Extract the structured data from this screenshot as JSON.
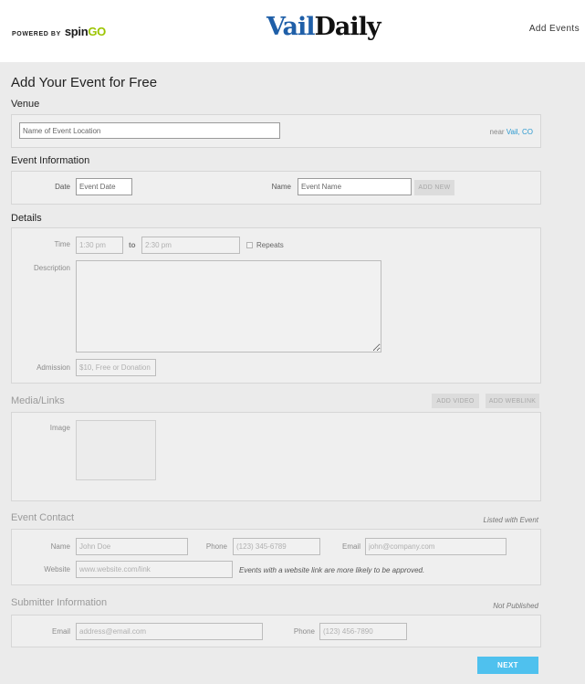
{
  "header": {
    "powered_by": "POWERED BY",
    "brand_part1": "spin",
    "brand_part2": "GO",
    "logo_part1": "Vail",
    "logo_part2": "Daily",
    "add_events": "Add Events"
  },
  "page": {
    "title": "Add Your Event for Free"
  },
  "venue": {
    "section": "Venue",
    "placeholder": "Name of Event Location",
    "near_prefix": "near",
    "near_location": "Vail, CO"
  },
  "event_info": {
    "section": "Event Information",
    "date_label": "Date",
    "date_placeholder": "Event Date",
    "name_label": "Name",
    "name_placeholder": "Event Name",
    "add_new": "ADD NEW"
  },
  "details": {
    "section": "Details",
    "time_label": "Time",
    "time_start": "1:30 pm",
    "to": "to",
    "time_end": "2:30 pm",
    "repeats": "Repeats",
    "description_label": "Description",
    "admission_label": "Admission",
    "admission_placeholder": "$10, Free or Donation"
  },
  "media": {
    "section": "Media/Links",
    "add_video": "ADD VIDEO",
    "add_weblink": "ADD WEBLINK",
    "image_label": "Image"
  },
  "contact": {
    "section": "Event Contact",
    "note": "Listed with Event",
    "name_label": "Name",
    "name_placeholder": "John Doe",
    "phone_label": "Phone",
    "phone_placeholder": "(123) 345-6789",
    "email_label": "Email",
    "email_placeholder": "john@company.com",
    "website_label": "Website",
    "website_placeholder": "www.website.com/link",
    "website_hint": "Events with a website link are more likely to be approved."
  },
  "submitter": {
    "section": "Submitter Information",
    "note": "Not Published",
    "email_label": "Email",
    "email_placeholder": "address@email.com",
    "phone_label": "Phone",
    "phone_placeholder": "(123) 456-7890"
  },
  "actions": {
    "next": "NEXT"
  },
  "colors": {
    "accent": "#4fc1ee",
    "logo_blue": "#1f5fa8",
    "brand_green": "#9bc400",
    "link": "#2e9ad0"
  }
}
